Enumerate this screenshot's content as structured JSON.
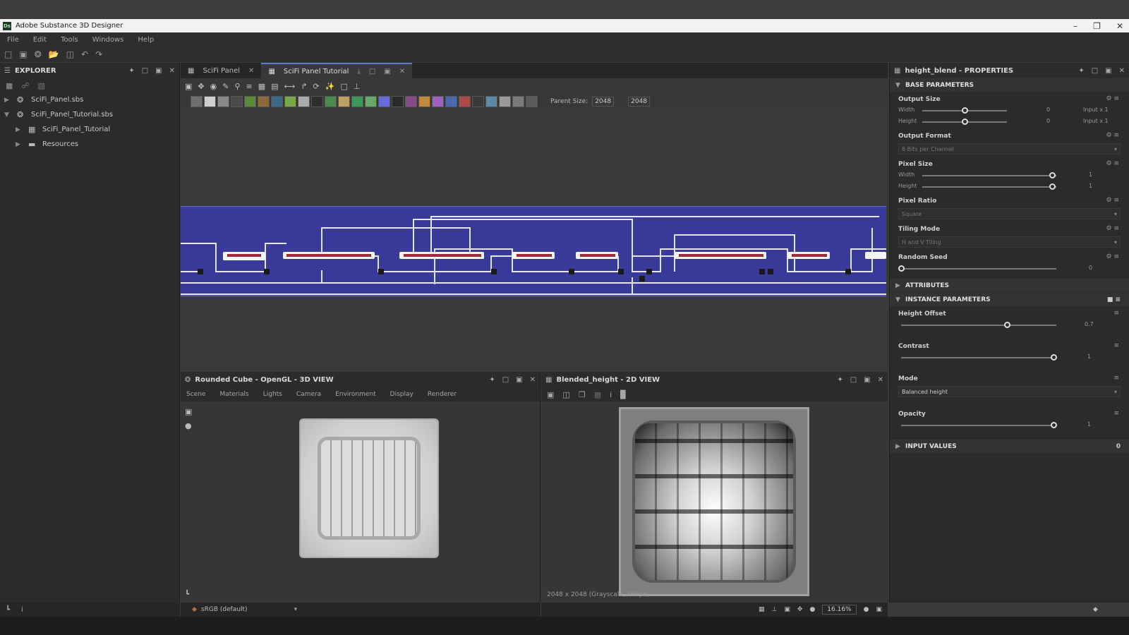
{
  "window": {
    "title": "Adobe Substance 3D Designer",
    "logo": "Ds"
  },
  "menu": [
    "File",
    "Edit",
    "Tools",
    "Windows",
    "Help"
  ],
  "explorer": {
    "title": "EXPLORER",
    "items": [
      {
        "label": "SciFi_Panel.sbs",
        "level": 0
      },
      {
        "label": "SciFi_Panel_Tutorial.sbs",
        "level": 0
      },
      {
        "label": "SciFi_Panel_Tutorial",
        "level": 1
      },
      {
        "label": "Resources",
        "level": 1
      }
    ]
  },
  "graph": {
    "tabs": [
      {
        "label": "SciFi Panel"
      },
      {
        "label": "SciFi Panel Tutorial"
      }
    ],
    "parent_size_label": "Parent Size:",
    "parent_size_value": "2048",
    "second_size_value": "2048"
  },
  "view3d": {
    "title": "Rounded Cube - OpenGL - 3D VIEW",
    "menu": [
      "Scene",
      "Materials",
      "Lights",
      "Camera",
      "Environment",
      "Display",
      "Renderer"
    ],
    "colorspace": "sRGB (default)"
  },
  "view2d": {
    "title": "Blended_height - 2D VIEW",
    "info": "2048 x 2048 (Grayscale, 16bpc)",
    "zoom": "16.16%"
  },
  "properties": {
    "title": "height_blend - PROPERTIES",
    "sections": {
      "base": "BASE PARAMETERS",
      "attributes": "ATTRIBUTES",
      "instance": "INSTANCE PARAMETERS",
      "inputs": "INPUT VALUES",
      "inputs_count": "0"
    },
    "output_size": {
      "label": "Output Size",
      "width_label": "Width",
      "height_label": "Height",
      "width_value": "0",
      "height_value": "0",
      "width_suffix": "Input x 1",
      "height_suffix": "Input x 1"
    },
    "output_format": {
      "label": "Output Format",
      "value": "8 Bits per Channel"
    },
    "pixel_size": {
      "label": "Pixel Size",
      "width_label": "Width",
      "height_label": "Height",
      "width_value": "1",
      "height_value": "1"
    },
    "pixel_ratio": {
      "label": "Pixel Ratio",
      "value": "Square"
    },
    "tiling_mode": {
      "label": "Tiling Mode",
      "value": "H and V Tiling"
    },
    "random_seed": {
      "label": "Random Seed",
      "value": "0"
    },
    "height_offset": {
      "label": "Height Offset",
      "value": "0.7",
      "fraction": 0.7
    },
    "contrast": {
      "label": "Contrast",
      "value": "1",
      "fraction": 1.0
    },
    "mode": {
      "label": "Mode",
      "value": "Balanced height"
    },
    "opacity": {
      "label": "Opacity",
      "value": "1",
      "fraction": 1.0
    }
  }
}
